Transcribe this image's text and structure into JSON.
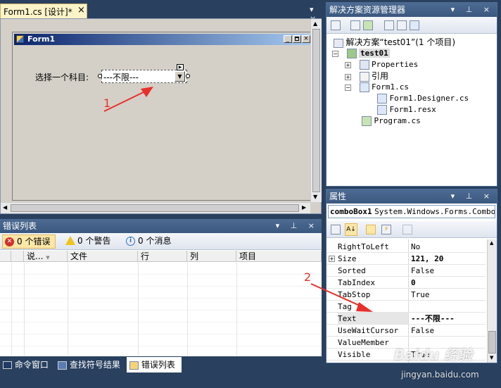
{
  "designer": {
    "tab_label": "Form1.cs [设计]*",
    "tab_close": "×",
    "form_title": "Form1",
    "label_text": "选择一个科目:",
    "combo_value": "---不限---"
  },
  "annotations": {
    "arrow1_label": "1",
    "arrow2_label": "2"
  },
  "solution_explorer": {
    "title": "解决方案资源管理器",
    "title_buttons": "▾ ⊥ ×",
    "solution_label": "解决方案“test01”(1 个项目)",
    "project_label": "test01",
    "items": [
      {
        "label": "Properties",
        "expander": "+"
      },
      {
        "label": "引用",
        "expander": "+"
      },
      {
        "label": "Form1.cs",
        "expander": "−"
      },
      {
        "label": "Form1.Designer.cs",
        "expander": ""
      },
      {
        "label": "Form1.resx",
        "expander": ""
      },
      {
        "label": "Program.cs",
        "expander": ""
      }
    ]
  },
  "error_list": {
    "title": "错误列表",
    "title_buttons": "▾ ⊥ ×",
    "errors_button": "0 个错误",
    "warnings_button": "0 个警告",
    "messages_button": "0 个消息",
    "columns": [
      "说...",
      "文件",
      "行",
      "列",
      "项目"
    ]
  },
  "properties": {
    "title": "属性",
    "title_buttons": "▾ ⊥ ×",
    "object_name": "comboBox1",
    "object_type": "System.Windows.Forms.Combo",
    "rows": [
      {
        "name": "RightToLeft",
        "value": "No",
        "bold": false,
        "expander": ""
      },
      {
        "name": "Size",
        "value": "121, 20",
        "bold": true,
        "expander": "+"
      },
      {
        "name": "Sorted",
        "value": "False",
        "bold": false,
        "expander": ""
      },
      {
        "name": "TabIndex",
        "value": "0",
        "bold": true,
        "expander": ""
      },
      {
        "name": "TabStop",
        "value": "True",
        "bold": false,
        "expander": ""
      },
      {
        "name": "Tag",
        "value": "",
        "bold": false,
        "expander": ""
      },
      {
        "name": "Text",
        "value": "---不限---",
        "bold": true,
        "expander": ""
      },
      {
        "name": "UseWaitCursor",
        "value": "False",
        "bold": false,
        "expander": ""
      },
      {
        "name": "ValueMember",
        "value": "",
        "bold": false,
        "expander": ""
      },
      {
        "name": "Visible",
        "value": "True",
        "bold": false,
        "expander": ""
      }
    ]
  },
  "bottom_tabs": [
    {
      "label": "命令窗口"
    },
    {
      "label": "查找符号结果"
    },
    {
      "label": "错误列表"
    }
  ],
  "watermark": {
    "line1": "Baidu 经验",
    "line2": "jingyan.baidu.com"
  }
}
